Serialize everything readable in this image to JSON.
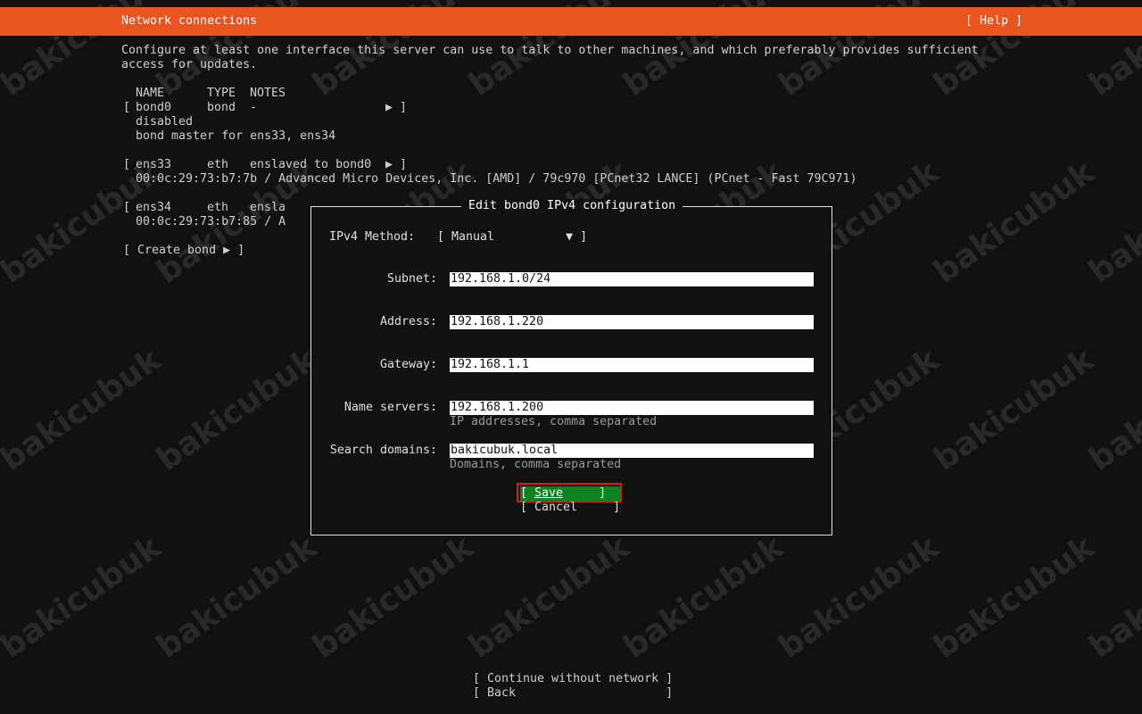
{
  "header": {
    "title": "Network connections",
    "help": "[ Help ]"
  },
  "description_line1": "Configure at least one interface this server can use to talk to other machines, and which preferably provides sufficient",
  "description_line2": "access for updates.",
  "table": {
    "columns": [
      "NAME",
      "TYPE",
      "NOTES"
    ],
    "rows": [
      {
        "open": "[",
        "name": "bond0",
        "type": "bond",
        "notes": "-",
        "arrow": "▶ ]",
        "details": [
          "disabled",
          "bond master for ens33, ens34"
        ]
      },
      {
        "open": "[",
        "name": "ens33",
        "type": "eth",
        "notes": "enslaved to bond0",
        "arrow": "▶ ]",
        "details": [
          "00:0c:29:73:b7:7b / Advanced Micro Devices, Inc. [AMD] / 79c970 [PCnet32 LANCE] (PCnet - Fast 79C971)"
        ]
      },
      {
        "open": "[",
        "name": "ens34",
        "type": "eth",
        "notes": "ensla",
        "details": [
          "00:0c:29:73:b7:85 / A"
        ]
      }
    ],
    "create_bond": "[ Create bond ▶ ]"
  },
  "dialog": {
    "title": "Edit bond0 IPv4 configuration",
    "method_label": "IPv4 Method:",
    "method_value": "[ Manual          ▼ ]",
    "fields": {
      "subnet": {
        "label": "Subnet:",
        "value": "192.168.1.0/24"
      },
      "address": {
        "label": "Address:",
        "value": "192.168.1.220"
      },
      "gateway": {
        "label": "Gateway:",
        "value": "192.168.1.1"
      },
      "name_servers": {
        "label": "Name servers:",
        "value": "192.168.1.200",
        "hint": "IP addresses, comma separated"
      },
      "search_domains": {
        "label": "Search domains:",
        "value": "bakicubuk.local",
        "hint": "Domains, comma separated"
      }
    },
    "save": {
      "open": "[ ",
      "label": "Save",
      "close": "     ]"
    },
    "cancel": "[ Cancel     ]"
  },
  "footer": {
    "continue": "[ Continue without network ]",
    "back": "[ Back                     ]"
  },
  "watermark": "bakicubuk",
  "colors": {
    "header_bg": "#e95420",
    "save_bg": "#0e8420",
    "highlight_border": "#d01f1f",
    "background": "#111111"
  }
}
